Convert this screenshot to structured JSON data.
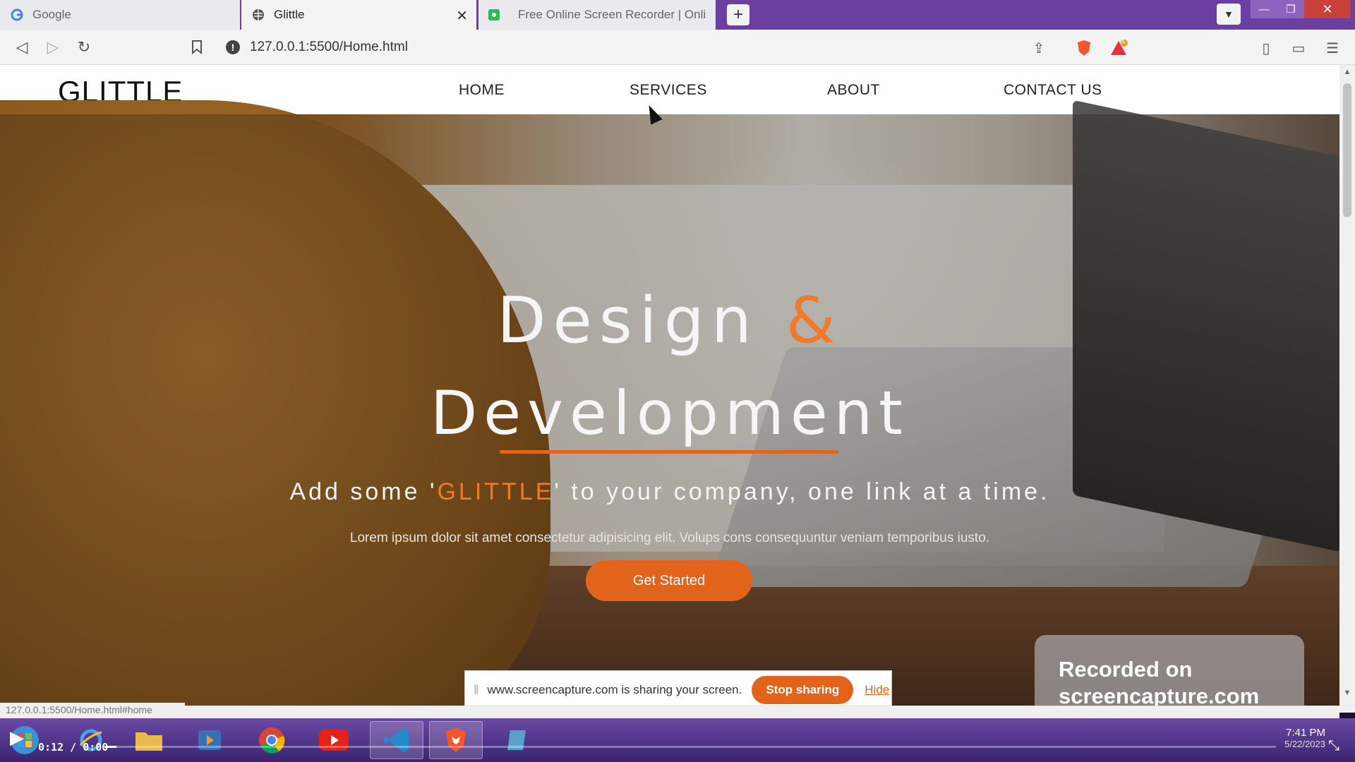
{
  "browser": {
    "tabs": [
      {
        "label": "Google",
        "icon": "google-icon"
      },
      {
        "label": "Glittle",
        "icon": "globe-icon"
      },
      {
        "label": "Free Online Screen Recorder | Onli",
        "icon": "recorder-icon"
      }
    ],
    "url": "127.0.0.1:5500/Home.html",
    "brave_badge": "1",
    "status_url": "127.0.0.1:5500/Home.html#home"
  },
  "site": {
    "logo": "GLITTLE",
    "nav": [
      "HOME",
      "SERVICES",
      "ABOUT",
      "CONTACT US"
    ],
    "hero": {
      "title_word": "Design",
      "title_amp": "&",
      "title_line2": "Development",
      "tagline_before": "Add some '",
      "tagline_brand": "GLITTLE",
      "tagline_after": "' to your company, one link at a time.",
      "lorem": "Lorem ipsum dolor sit amet consectetur adipisicing elit. Volups cons consequuntur veniam temporibus iusto.",
      "cta": "Get Started"
    },
    "accent_color": "#e2641a"
  },
  "share": {
    "message": "www.screencapture.com is sharing your screen.",
    "stop_label": "Stop sharing",
    "hide_label": "Hide"
  },
  "watermark": {
    "line1": "Recorded on",
    "line2": "screencapture.com"
  },
  "player": {
    "time": "0:12 / 0:00",
    "progress": 0.01,
    "clock_time": "7:41 PM",
    "clock_date": "5/22/2023"
  }
}
